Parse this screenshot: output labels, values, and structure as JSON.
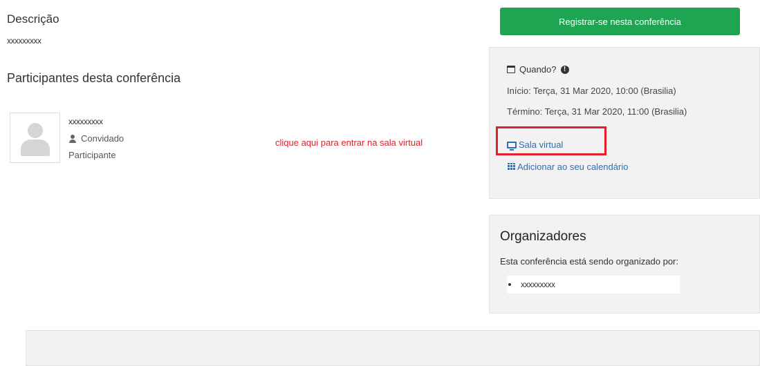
{
  "description": {
    "heading": "Descrição",
    "value": "xxxxxxxxx"
  },
  "participants": {
    "heading": "Participantes desta conferência",
    "items": [
      {
        "name": "xxxxxxxxx",
        "role": "Convidado",
        "type": "Participante"
      }
    ]
  },
  "hint_text": "clique aqui para entrar na sala virtual",
  "register_button": "Registrar-se nesta conferência",
  "when": {
    "label": "Quando?",
    "start": "Início: Terça, 31 Mar 2020, 10:00 (Brasilia)",
    "end": "Término: Terça, 31 Mar 2020, 11:00 (Brasilia)",
    "room_link": "Sala virtual",
    "calendar_link": "Adicionar ao seu calendário"
  },
  "organizers": {
    "title": "Organizadores",
    "description": "Esta conferência está sendo organizado por:",
    "items": [
      "xxxxxxxxx"
    ]
  },
  "colors": {
    "register_green": "#1fa552",
    "link_blue": "#2a6fb5",
    "highlight_red": "#e0202a"
  }
}
